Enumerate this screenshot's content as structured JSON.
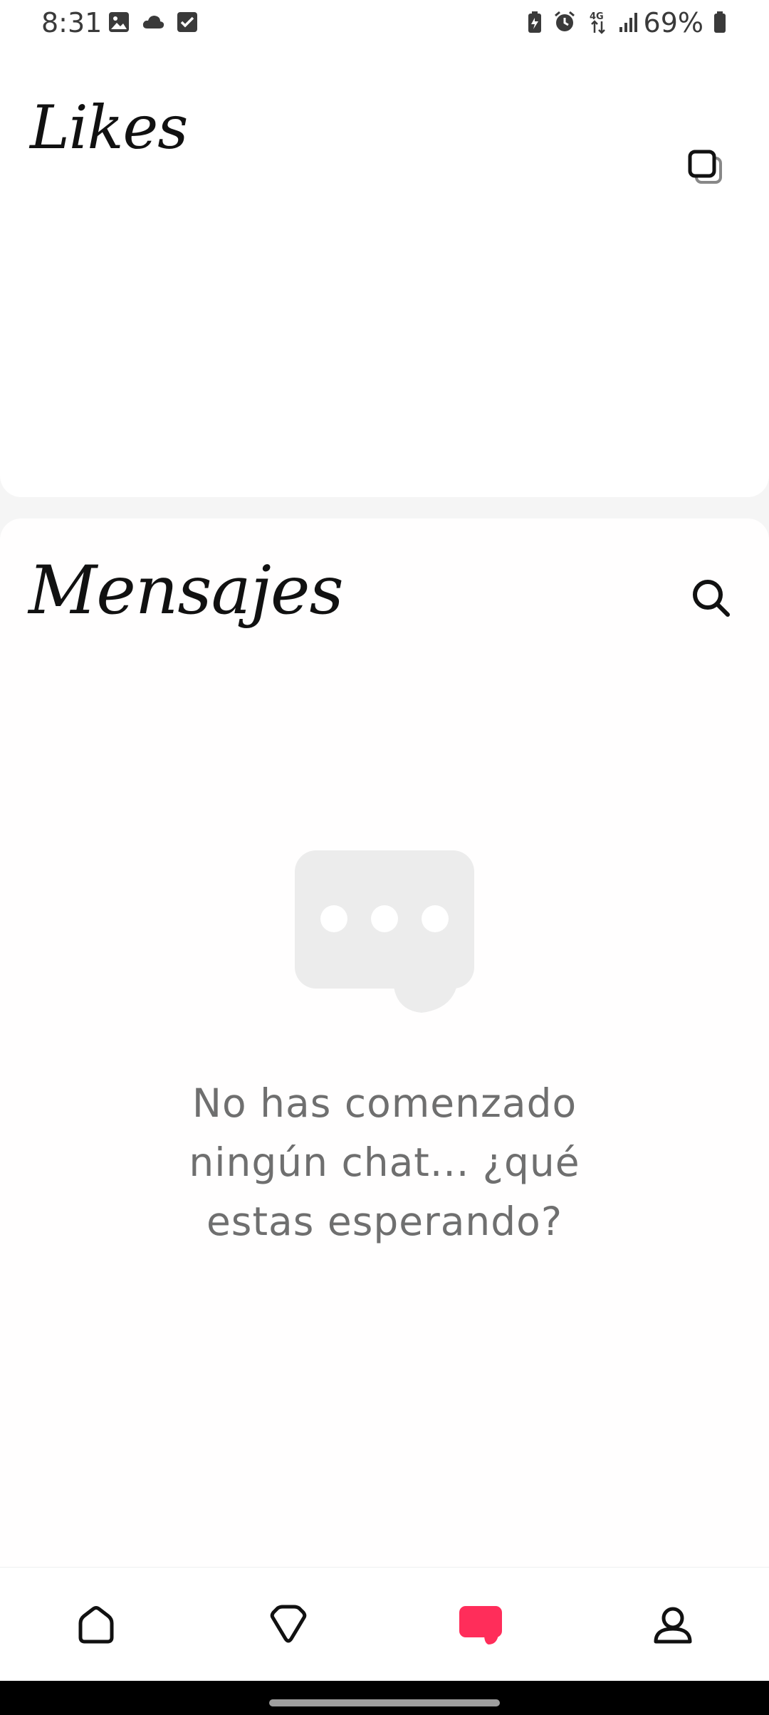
{
  "status_bar": {
    "time": "8:31",
    "battery_percent": "69%",
    "left_icons": [
      "gallery-icon",
      "cloud-icon",
      "checkbox-icon"
    ],
    "right_icons": [
      "battery-saver-icon",
      "alarm-icon",
      "network-4g-icon",
      "signal-icon",
      "battery-icon"
    ]
  },
  "likes": {
    "title": "Likes",
    "action_icon": "copy-icon"
  },
  "messages": {
    "title": "Mensajes",
    "search_icon": "search-icon",
    "empty_icon": "chat-bubble-icon",
    "empty_text": "No has comenzado ningún chat... ¿qué estas esperando?"
  },
  "bottom_nav": {
    "items": [
      {
        "icon": "home-icon",
        "active": false
      },
      {
        "icon": "diamond-icon",
        "active": false
      },
      {
        "icon": "chat-icon",
        "active": true
      },
      {
        "icon": "profile-icon",
        "active": false
      }
    ],
    "active_color": "#ff2d5a",
    "inactive_color": "#111111"
  },
  "colors": {
    "empty_illustration": "#ececec",
    "empty_text": "#6f6f6f"
  }
}
